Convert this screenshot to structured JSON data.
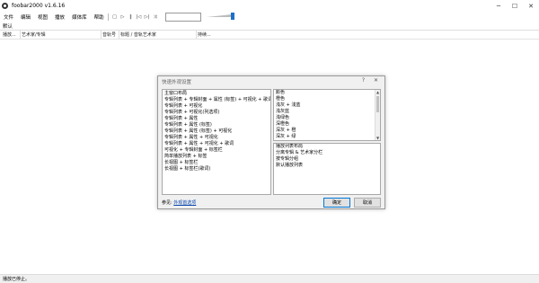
{
  "window": {
    "title": "foobar2000 v1.6.16",
    "controls": [
      "─",
      "☐",
      "✕"
    ]
  },
  "menu": [
    "文件",
    "编辑",
    "视图",
    "播放",
    "媒体库",
    "帮助"
  ],
  "toolbar": {
    "buttons": [
      "□",
      "▷",
      "‖",
      "|◁",
      "▷|",
      "⤨"
    ]
  },
  "tabs": {
    "default_label": "默认"
  },
  "columns": [
    "播放...",
    "艺术家/专辑",
    "音轨号",
    "标题 / 音轨艺术家",
    "持续..."
  ],
  "dialog": {
    "title": "快速外观设置",
    "help": "?",
    "close": "✕",
    "left_list": {
      "header": "主窗口布局",
      "items": [
        "专辑列表 + 专辑封面 + 属性 (标签) + 可视化 + 歌词",
        "专辑列表 + 可视化",
        "专辑列表 + 可视化(列选项)",
        "专辑列表 + 属性",
        "专辑列表 + 属性 (标签)",
        "专辑列表 + 属性 (标签) + 可视化",
        "专辑列表 + 属性 + 可视化",
        "专辑列表 + 属性 + 可视化 + 歌词",
        "可视化 + 专辑封面 + 标签栏",
        "简单播放列表 + 标签",
        "长视图 + 标签栏",
        "长视图 + 标签栏(歌词)"
      ]
    },
    "right_top_list": {
      "header": "颜色",
      "items": [
        "橙色",
        "浅灰 + 浅蓝",
        "浅灰蓝",
        "浅绿色",
        "深橙色",
        "深灰 + 橙",
        "深灰 + 绿"
      ]
    },
    "right_bottom_list": {
      "header": "播放列表布局",
      "items": [
        "分离专辑 & 艺术家分栏",
        "按专辑分组",
        "默认播放列表"
      ]
    },
    "reference_prefix": "参见:",
    "reference_link": "外观首选项",
    "ok_label": "确定",
    "cancel_label": "取消"
  },
  "status": {
    "text": "播放已停止。"
  },
  "colors": {
    "accent": "#1e6fc8",
    "link": "#0645ad"
  }
}
